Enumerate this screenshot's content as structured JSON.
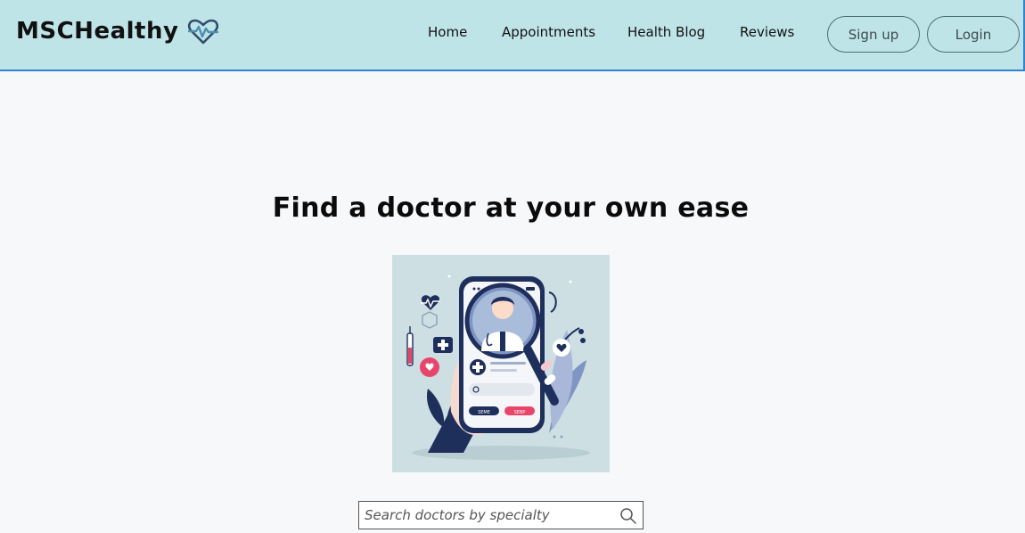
{
  "brand": {
    "name": "MSCHealthy",
    "icon": "heartbeat-heart-icon"
  },
  "nav": {
    "items": [
      {
        "label": "Home"
      },
      {
        "label": "Appointments"
      },
      {
        "label": "Health Blog"
      },
      {
        "label": "Reviews"
      }
    ],
    "signup_label": "Sign up",
    "login_label": "Login"
  },
  "main": {
    "title": "Find a doctor at your own ease",
    "hero_image": "doctor-search-phone-illustration"
  },
  "search": {
    "placeholder": "Search doctors by specialty",
    "value": "",
    "icon": "search-icon"
  },
  "colors": {
    "header_bg": "#bfe4e8",
    "header_border": "#2c86d4",
    "page_bg": "#f7f8fa",
    "illustration_bg": "#cddfe2",
    "navy": "#1e2f5c",
    "accent_pink": "#e8456b"
  }
}
